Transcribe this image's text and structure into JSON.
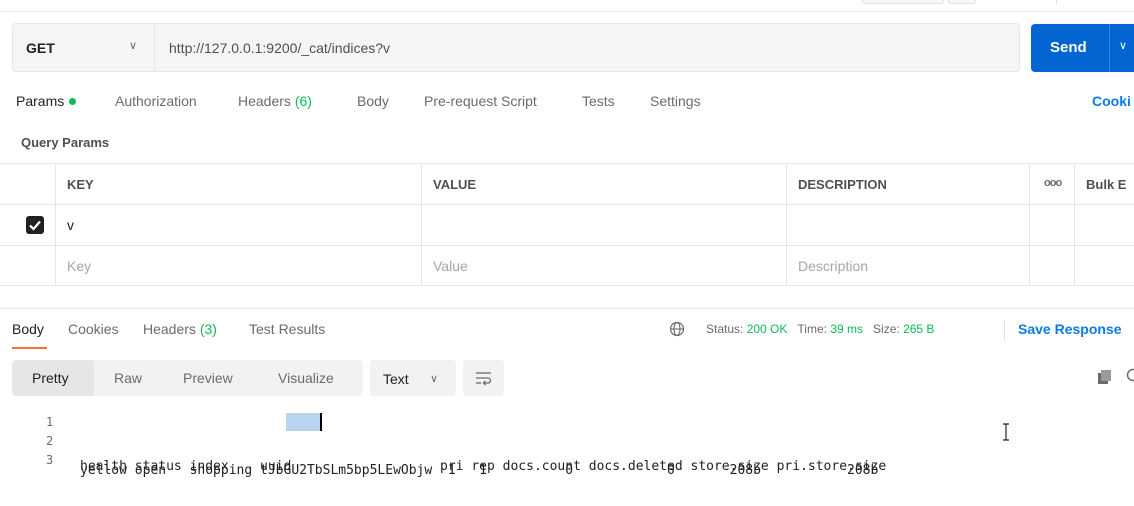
{
  "request": {
    "method": "GET",
    "url": "http://127.0.0.1:9200/_cat/indices?v",
    "send_label": "Send"
  },
  "request_tabs": [
    {
      "label": "Params",
      "active": true
    },
    {
      "label": "Authorization"
    },
    {
      "label": "Headers",
      "count": "(6)"
    },
    {
      "label": "Body"
    },
    {
      "label": "Pre-request Script"
    },
    {
      "label": "Tests"
    },
    {
      "label": "Settings"
    }
  ],
  "cookies_label": "Cooki",
  "query_params": {
    "title": "Query Params",
    "headers": [
      "KEY",
      "VALUE",
      "DESCRIPTION",
      "ooo",
      "Bulk E"
    ],
    "rows": [
      {
        "checked": true,
        "key": "v",
        "value": "",
        "description": ""
      }
    ],
    "placeholders": {
      "key": "Key",
      "value": "Value",
      "description": "Description"
    }
  },
  "response_tabs": [
    {
      "label": "Body",
      "active": true
    },
    {
      "label": "Cookies"
    },
    {
      "label": "Headers",
      "count": "(3)"
    },
    {
      "label": "Test Results"
    }
  ],
  "response_meta": {
    "status_label": "Status:",
    "status_value": "200 OK",
    "time_label": "Time:",
    "time_value": "39 ms",
    "size_label": "Size:",
    "size_value": "265 B",
    "save_label": "Save Response"
  },
  "body_formats": [
    "Pretty",
    "Raw",
    "Preview",
    "Visualize"
  ],
  "text_type": "Text",
  "code_lines": [
    {
      "n": "1",
      "pre": "health status index    ",
      "hl": "uuid",
      "post": "                   pri rep docs.count docs.deleted store.size pri.store.size"
    },
    {
      "n": "2",
      "text": "yellow open   shopping tJbGU2TbSLm5bp5LEwObjw  1   1          0            0       208b           208b"
    },
    {
      "n": "3",
      "text": ""
    }
  ],
  "colors": {
    "accent": "#ff6c37",
    "send": "#0265d2",
    "link": "#097bed",
    "ok": "#0cbb52"
  }
}
